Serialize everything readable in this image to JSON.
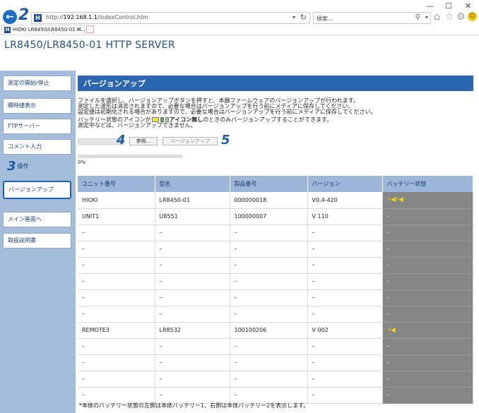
{
  "browser": {
    "back_glyph": "←",
    "callout_2": "2",
    "favicon_letter": "H",
    "url_prefix": "http://",
    "url_host": "192.168.1.1",
    "url_path": "/indexControl.htm",
    "url_dropdown": "▾",
    "refresh_glyph": "↻",
    "search_placeholder": "検索...",
    "search_glyph": "⚲",
    "search_dropdown": "▾",
    "home_glyph": "⌂",
    "star_glyph": "☆",
    "gear_glyph": "⚙",
    "smile_glyph": "☺",
    "min_glyph": "—",
    "max_glyph": "☐",
    "close_glyph": "✕",
    "tab_title": "HIOKI LR8450/LR8450-01 H...",
    "tab_close": "×"
  },
  "header": {
    "title": "LR8450/LR8450-01 HTTP SERVER"
  },
  "sidebar": {
    "items": [
      {
        "label": "測定の開始/停止"
      },
      {
        "label": "瞬時値表示"
      },
      {
        "label": "FTPサーバー"
      },
      {
        "label": "コメント入力"
      },
      {
        "label": "操作"
      },
      {
        "label": "バージョンアップ"
      },
      {
        "label": "メイン画面へ"
      },
      {
        "label": "取扱説明書"
      }
    ],
    "callout_3": "3"
  },
  "content": {
    "title": "バージョンアップ",
    "desc_line1": "ファイルを選択し、バージョンアップボタンを押すと、本器ファームウェアのバージョンアップが行われます。",
    "desc_line2": "測定した波形は消去されますので、必要な場合はバージョンアップを行う前にメディアに保存してください。",
    "desc_line3": "設定値は初期化される場合がありますので、必要な場合はバージョンアップを行う前にメディアに保存してください。",
    "desc_line4_a": "バッテリー状態のアイコンが",
    "desc_line4_b": "アイコン無し",
    "desc_line4_c": "のときのみバージョンアップすることができます。",
    "desc_line5": "測定中などは、バージョンアップできません。",
    "callout_4": "4",
    "callout_5": "5",
    "browse_label": "参照...",
    "update_label": "バージョンアップ",
    "progress_percent": 0,
    "progress_label": "0%"
  },
  "table": {
    "headers": [
      "ユニット番号",
      "型名",
      "製品番号",
      "バージョン",
      "バッテリー状態"
    ],
    "rows": [
      [
        "HIOKI",
        "LR8450-01",
        "000000018",
        "V0.4-420",
        "plug-plug"
      ],
      [
        "UNIT1",
        "U8551",
        "100000007",
        "V 110",
        "–"
      ],
      [
        "–",
        "–",
        "–",
        "–",
        "–"
      ],
      [
        "–",
        "–",
        "–",
        "–",
        "–"
      ],
      [
        "–",
        "–",
        "–",
        "–",
        "–"
      ],
      [
        "–",
        "–",
        "–",
        "–",
        "–"
      ],
      [
        "–",
        "–",
        "–",
        "–",
        "–"
      ],
      [
        "–",
        "–",
        "–",
        "–",
        "–"
      ],
      [
        "REMOTE3",
        "LR8532",
        "100100206",
        "V 002",
        "plug"
      ],
      [
        "–",
        "–",
        "–",
        "–",
        "–"
      ],
      [
        "–",
        "–",
        "–",
        "–",
        "–"
      ],
      [
        "–",
        "–",
        "–",
        "–",
        "–"
      ],
      [
        "–",
        "–",
        "–",
        "–",
        "–"
      ]
    ],
    "plug_glyph": "⚡◀"
  },
  "footnote": "*本体のバッテリー状態の左側は本体バッテリー1、右側は本体バッテリー2を表示します。",
  "colors": {
    "accent": "#2b66b0",
    "sidebar_bg": "#a3bddb",
    "table_header": "#9bb6d8",
    "battery_col": "#868686",
    "callout": "#1a5ea8"
  }
}
